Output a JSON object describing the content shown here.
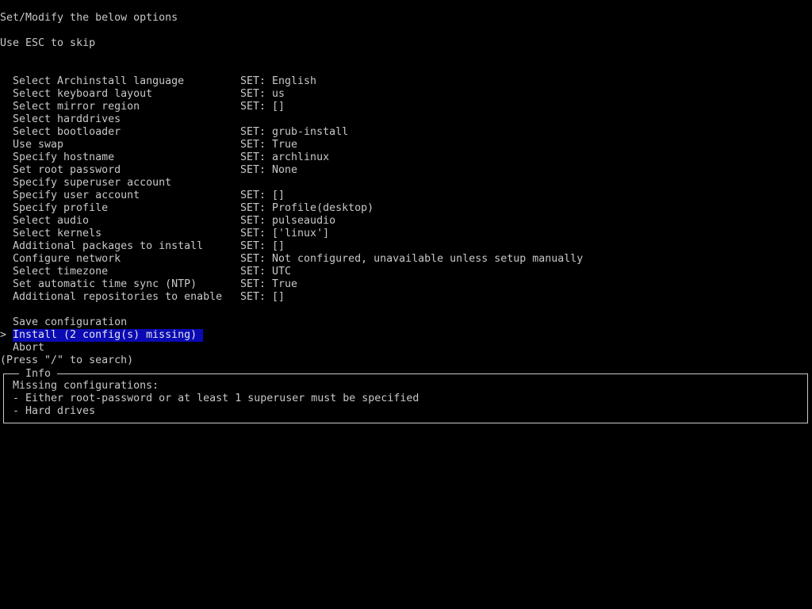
{
  "header": {
    "title": "Set/Modify the below options",
    "hint": "Use ESC to skip"
  },
  "options": [
    {
      "label": "Select Archinstall language",
      "value": "SET: English"
    },
    {
      "label": "Select keyboard layout",
      "value": "SET: us"
    },
    {
      "label": "Select mirror region",
      "value": "SET: []"
    },
    {
      "label": "Select harddrives",
      "value": ""
    },
    {
      "label": "Select bootloader",
      "value": "SET: grub-install"
    },
    {
      "label": "Use swap",
      "value": "SET: True"
    },
    {
      "label": "Specify hostname",
      "value": "SET: archlinux"
    },
    {
      "label": "Set root password",
      "value": "SET: None"
    },
    {
      "label": "Specify superuser account",
      "value": ""
    },
    {
      "label": "Specify user account",
      "value": "SET: []"
    },
    {
      "label": "Specify profile",
      "value": "SET: Profile(desktop)"
    },
    {
      "label": "Select audio",
      "value": "SET: pulseaudio"
    },
    {
      "label": "Select kernels",
      "value": "SET: ['linux']"
    },
    {
      "label": "Additional packages to install",
      "value": "SET: []"
    },
    {
      "label": "Configure network",
      "value": "SET: Not configured, unavailable unless setup manually"
    },
    {
      "label": "Select timezone",
      "value": "SET: UTC"
    },
    {
      "label": "Set automatic time sync (NTP)",
      "value": "SET: True"
    },
    {
      "label": "Additional repositories to enable",
      "value": "SET: []"
    }
  ],
  "actions": {
    "save": "Save configuration",
    "install": "Install (2 config(s) missing)",
    "abort": "Abort",
    "cursor": ">"
  },
  "search_hint": "(Press \"/\" to search)",
  "info": {
    "title": "Info",
    "lines": [
      "Missing configurations:",
      "- Either root-password or at least 1 superuser must be specified",
      "- Hard drives"
    ]
  },
  "colors": {
    "background": "#000000",
    "foreground": "#c8c8c8",
    "selection": "#0a0ab4"
  }
}
